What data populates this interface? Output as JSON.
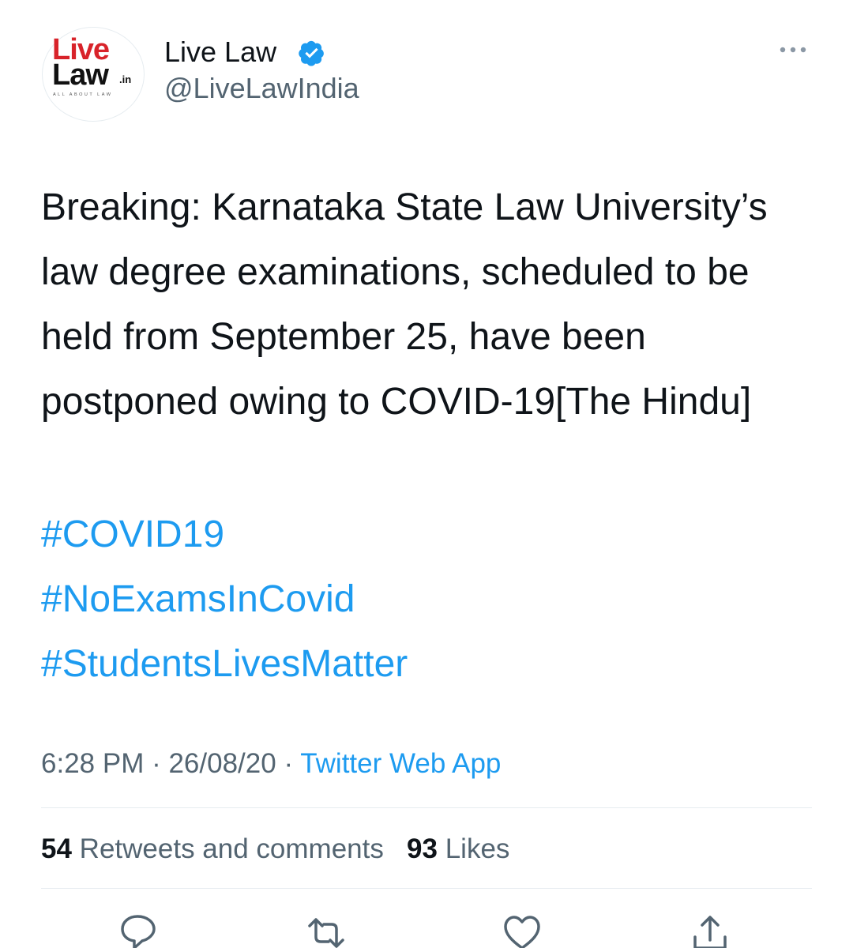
{
  "author": {
    "name": "Live Law",
    "handle": "@LiveLawIndia",
    "logo": {
      "word1": "Live",
      "word2": "Law",
      "suffix": ".in",
      "tagline": "ALL ABOUT LAW"
    },
    "verified_icon": "verified-badge-icon"
  },
  "tweet": {
    "text": "Breaking: Karnataka State Law University’s law degree examinations, scheduled to be held from September 25, have been postponed owing to COVID-19[The Hindu]",
    "hashtags": [
      "#COVID19",
      "#NoExamsInCovid",
      "#StudentsLivesMatter"
    ],
    "time": "6:28 PM",
    "date": "26/08/20",
    "source": "Twitter Web App",
    "separator": " · "
  },
  "stats": {
    "retweets_count": "54",
    "retweets_label": "Retweets and comments",
    "likes_count": "93",
    "likes_label": "Likes"
  },
  "actions": [
    "reply-icon",
    "retweet-icon",
    "like-icon",
    "share-icon"
  ],
  "colors": {
    "link": "#1d9bf0",
    "text": "#0f1419",
    "secondary": "#536471",
    "logo_red": "#d8232a"
  }
}
